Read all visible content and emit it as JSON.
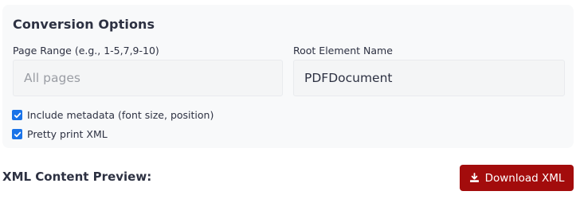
{
  "conversion_options": {
    "title": "Conversion Options",
    "page_range": {
      "label": "Page Range (e.g., 1-5,7,9-10)",
      "value": "",
      "placeholder": "All pages"
    },
    "root_element": {
      "label": "Root Element Name",
      "value": "PDFDocument",
      "placeholder": ""
    },
    "options": [
      {
        "label": "Include metadata (font size, position)",
        "checked": true
      },
      {
        "label": "Pretty print XML",
        "checked": true
      }
    ]
  },
  "preview": {
    "title": "XML Content Preview:",
    "download_label": "Download XML",
    "download_icon": "download-icon"
  },
  "colors": {
    "panel_bg": "#f8f9fa",
    "checkbox_accent": "#1a73e8",
    "download_button_bg": "#a30c0c"
  }
}
